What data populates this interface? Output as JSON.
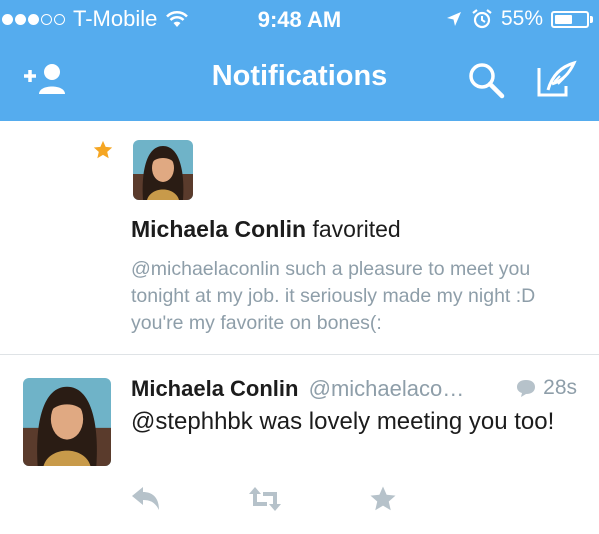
{
  "status_bar": {
    "carrier": "T-Mobile",
    "time": "9:48 AM",
    "battery_percent": "55%",
    "battery_level": 0.55,
    "signal_bars_filled": 3,
    "signal_bars_total": 5
  },
  "nav": {
    "title": "Notifications",
    "left_icon": "add-user-icon",
    "right_icons": [
      "search-icon",
      "compose-icon"
    ]
  },
  "notification": {
    "type_icon": "star-icon",
    "user_name": "Michaela Conlin",
    "action": "favorited",
    "quoted_text": "@michaelaconlin such a pleasure to meet you tonight at my job. it seriously made my night :D you're my favorite on bones(:"
  },
  "tweet": {
    "user_name": "Michaela Conlin",
    "handle": "@michaelaco…",
    "time": "28s",
    "text": "@stephhbk was lovely meeting you too!",
    "actions": [
      "reply-icon",
      "retweet-icon",
      "favorite-icon"
    ]
  },
  "colors": {
    "header_bg": "#55acee",
    "accent_star": "#f5a623",
    "muted_text": "#8e9ea9",
    "action_icon": "#b6c2ca"
  }
}
